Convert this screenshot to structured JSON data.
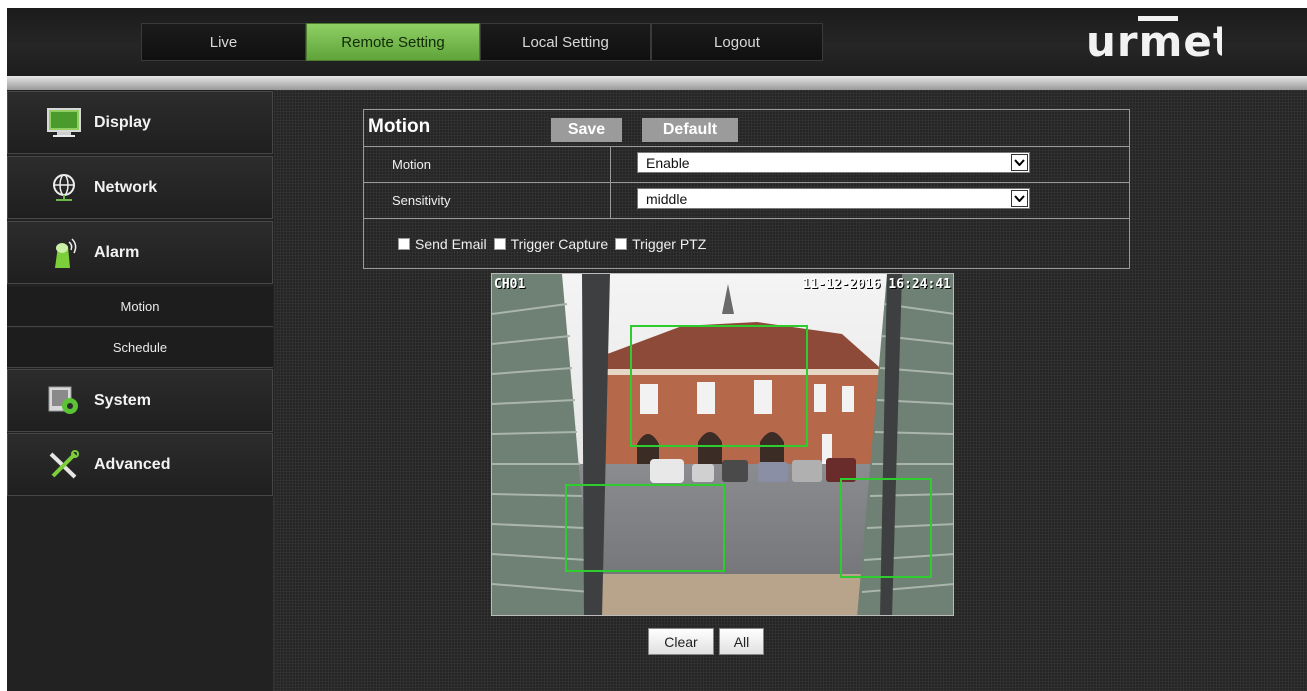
{
  "header": {
    "tabs": [
      {
        "label": "Live",
        "active": false
      },
      {
        "label": "Remote Setting",
        "active": true
      },
      {
        "label": "Local Setting",
        "active": false
      },
      {
        "label": "Logout",
        "active": false
      }
    ],
    "logo_text": "urmet",
    "accent_color": "#6fb547"
  },
  "sidebar": {
    "items": [
      {
        "label": "Display",
        "icon": "monitor-icon"
      },
      {
        "label": "Network",
        "icon": "globe-network-icon"
      },
      {
        "label": "Alarm",
        "icon": "alarm-siren-icon"
      },
      {
        "label": "System",
        "icon": "system-gear-icon"
      },
      {
        "label": "Advanced",
        "icon": "tools-icon"
      }
    ],
    "alarm_submenu": [
      {
        "label": "Motion"
      },
      {
        "label": "Schedule"
      }
    ]
  },
  "panel": {
    "title": "Motion",
    "save_label": "Save",
    "default_label": "Default",
    "rows": [
      {
        "label": "Motion",
        "value": "Enable"
      },
      {
        "label": "Sensitivity",
        "value": "middle"
      }
    ],
    "checkboxes": [
      {
        "label": "Send Email",
        "checked": false
      },
      {
        "label": "Trigger Capture",
        "checked": false
      },
      {
        "label": "Trigger PTZ",
        "checked": false
      }
    ]
  },
  "camera": {
    "channel": "CH01",
    "timestamp": "11-12-2016 16:24:41"
  },
  "actions": {
    "clear_label": "Clear",
    "all_label": "All"
  }
}
